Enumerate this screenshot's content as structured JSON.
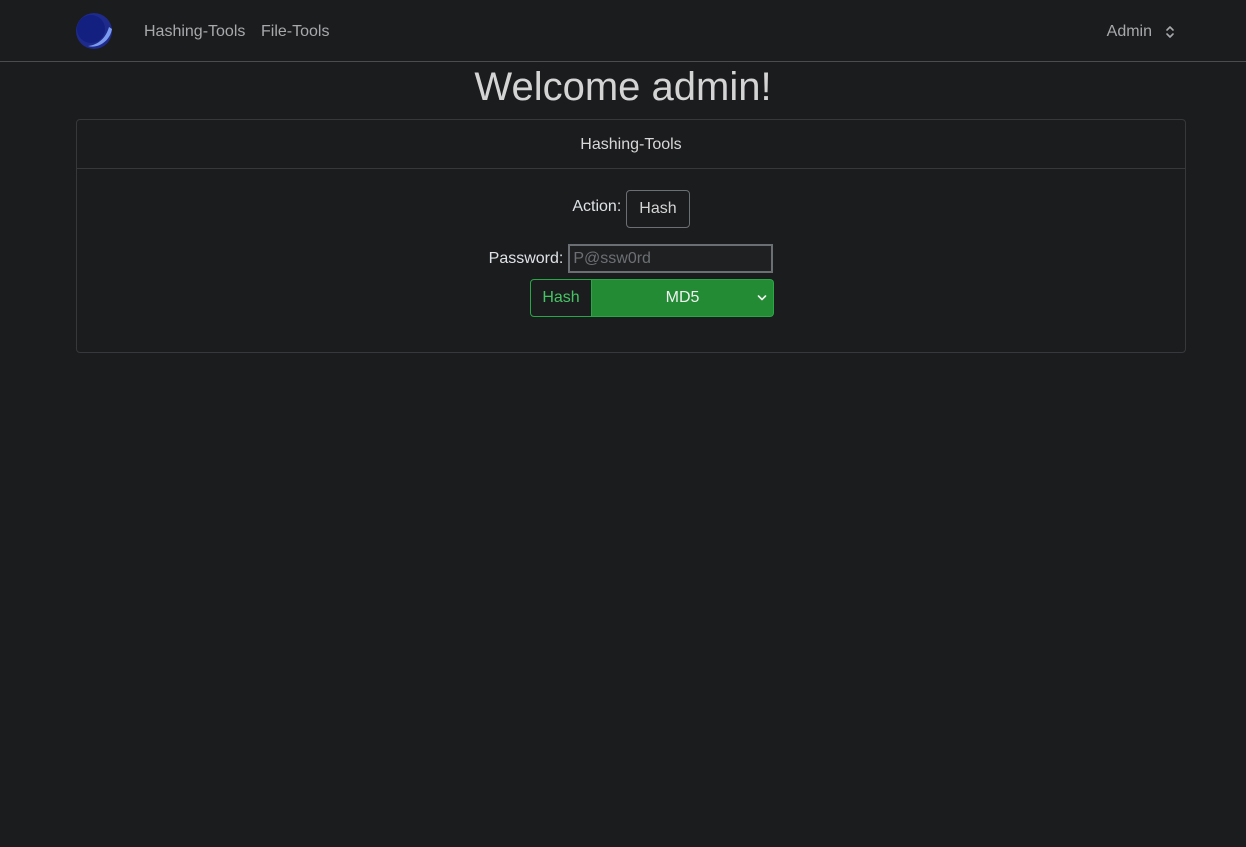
{
  "navbar": {
    "logo_icon": "moon-planet-logo-icon",
    "links": [
      {
        "label": "Hashing-Tools"
      },
      {
        "label": "File-Tools"
      }
    ],
    "user": {
      "label": "Admin",
      "icon": "chevron-up-down-icon"
    }
  },
  "welcome": "Welcome admin!",
  "card": {
    "title": "Hashing-Tools",
    "action_label": "Action:",
    "action_value": "Hash",
    "password_label": "Password:",
    "password_placeholder": "P@ssw0rd",
    "password_value": "",
    "submit_label": "Hash",
    "algorithm_selected": "MD5",
    "accent_color": "#228b34"
  }
}
